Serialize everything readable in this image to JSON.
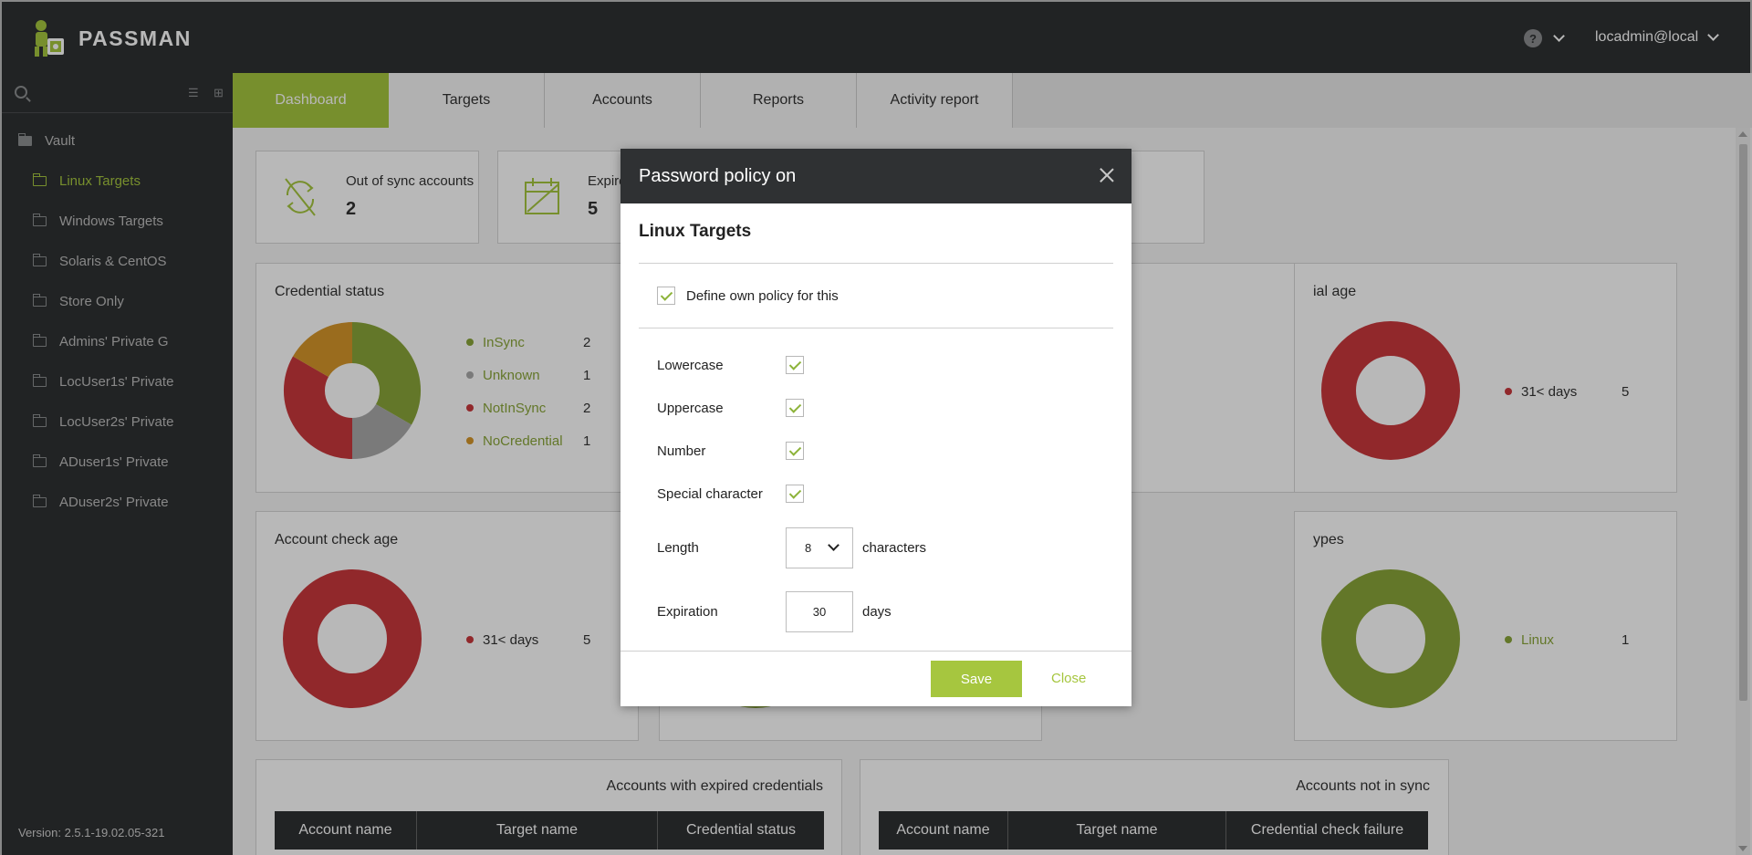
{
  "app": {
    "name": "PASSMAN",
    "user": "locadmin@local",
    "help": "?",
    "version": "Version: 2.5.1-19.02.05-321"
  },
  "sidebar": {
    "root": {
      "label": "Vault"
    },
    "items": [
      {
        "label": "Linux Targets",
        "active": true
      },
      {
        "label": "Windows Targets"
      },
      {
        "label": "Solaris & CentOS"
      },
      {
        "label": "Store Only"
      },
      {
        "label": "Admins' Private G"
      },
      {
        "label": "LocUser1s' Private"
      },
      {
        "label": "LocUser2s' Private"
      },
      {
        "label": "ADuser1s' Private"
      },
      {
        "label": "ADuser2s' Private"
      }
    ]
  },
  "tabs": [
    {
      "label": "Dashboard",
      "active": true
    },
    {
      "label": "Targets"
    },
    {
      "label": "Accounts"
    },
    {
      "label": "Reports"
    },
    {
      "label": "Activity report"
    }
  ],
  "stats": [
    {
      "label": "Out of sync accounts",
      "value": "2"
    },
    {
      "label": "Expire",
      "value": "5"
    }
  ],
  "cards": {
    "credential_status": {
      "title": "Credential status",
      "legend": [
        {
          "label": "InSync",
          "value": "2",
          "color": "#8aa63a"
        },
        {
          "label": "Unknown",
          "value": "1",
          "color": "#a9a9a9"
        },
        {
          "label": "NotInSync",
          "value": "2",
          "color": "#c9383c"
        },
        {
          "label": "NoCredential",
          "value": "1",
          "color": "#d6962a"
        }
      ]
    },
    "credential_age": {
      "title": "ial age",
      "legend": [
        {
          "label": "31< days",
          "value": "5",
          "color": "#c9383c"
        }
      ]
    },
    "account_check_age": {
      "title": "Account check age",
      "legend": [
        {
          "label": "31< days",
          "value": "5",
          "color": "#c9383c"
        }
      ]
    },
    "target_types": {
      "title": "ypes",
      "legend": [
        {
          "label": "Linux",
          "value": "1",
          "color": "#8aa63a"
        }
      ]
    }
  },
  "tables": {
    "expired": {
      "title": "Accounts with expired credentials",
      "columns": [
        "Account name",
        "Target name",
        "Credential status"
      ]
    },
    "not_in_sync": {
      "title": "Accounts not in sync",
      "columns": [
        "Account name",
        "Target name",
        "Credential check failure"
      ]
    }
  },
  "modal": {
    "title": "Password policy on",
    "subtitle": "Linux Targets",
    "define_own": "Define own policy for this",
    "options": [
      {
        "label": "Lowercase",
        "checked": true
      },
      {
        "label": "Uppercase",
        "checked": true
      },
      {
        "label": "Number",
        "checked": true
      },
      {
        "label": "Special character",
        "checked": true
      }
    ],
    "length": {
      "label": "Length",
      "value": "8",
      "suffix": "characters"
    },
    "expiration": {
      "label": "Expiration",
      "value": "30",
      "suffix": "days"
    },
    "save": "Save",
    "close": "Close"
  },
  "colors": {
    "accent": "#a6c63f",
    "dark": "#2f3133",
    "red": "#c9383c",
    "green": "#8aa63a"
  }
}
